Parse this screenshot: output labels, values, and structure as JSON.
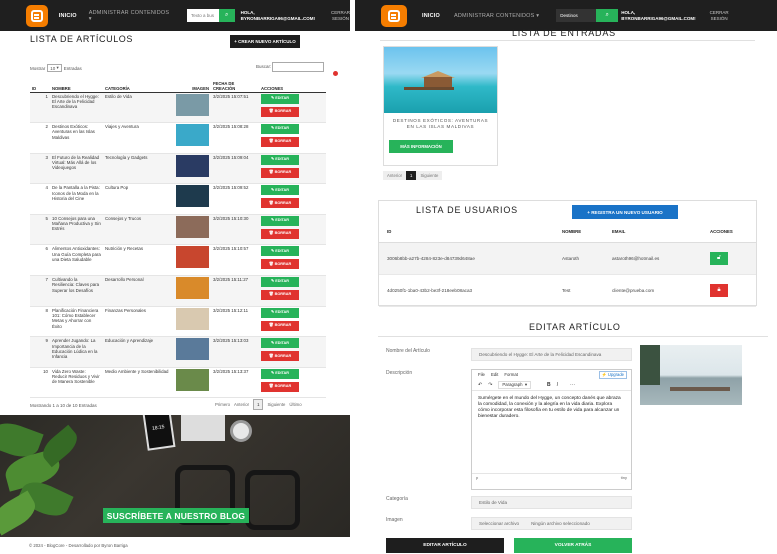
{
  "left": {
    "nav": {
      "home": "INICIO",
      "manage": "ADMINISTRAR CONTENIDOS",
      "search_placeholder": "Texto a bus",
      "user_line1": "HOLA,",
      "user_line2": "BYRONBARRIGA96@GMAIL.COM!",
      "logout_line1": "CERRAR",
      "logout_line2": "SESIÓN"
    },
    "title": "LISTA DE ARTÍCULOS",
    "new_button": "+ CREAR NUEVO ARTÍCULO",
    "show_label": "Mostrar",
    "show_value": "10",
    "entries_label": "Entradas",
    "search_label": "Buscar:",
    "columns": [
      "ID",
      "NOMBRE",
      "CATEGORÍA",
      "IMAGEN",
      "FECHA DE CREACIÓN",
      "ACCIONES"
    ],
    "edit_label": "✎ EDITAR",
    "delete_label": "🗑 BORRAR",
    "rows": [
      {
        "id": "1",
        "name": "Descubriendo el Hygge: El Arte de la Felicidad Escandinava",
        "category": "Estilo de Vida",
        "date": "3/2/2025 15:07:51",
        "img": "#7a9aa6"
      },
      {
        "id": "2",
        "name": "Destinos Exóticos: Aventuras en las Islas Maldivas",
        "category": "Viajes y Aventura",
        "date": "3/2/2025 15:08:28",
        "img": "#3aa9c9"
      },
      {
        "id": "3",
        "name": "El Futuro de la Realidad Virtual: Más Allá de los Videojuegos",
        "category": "Tecnología y Gadgets",
        "date": "3/2/2025 15:09:04",
        "img": "#2a3b63"
      },
      {
        "id": "4",
        "name": "De la Pantalla a la Pista: Iconos de la Moda en la Historia del Cine",
        "category": "Cultura Pop",
        "date": "3/2/2025 15:09:52",
        "img": "#1e3a4d"
      },
      {
        "id": "5",
        "name": "10 Consejos para una Mañana Productiva y Sin Estrés",
        "category": "Consejos y Trucos",
        "date": "3/2/2025 15:10:30",
        "img": "#8c6b5a"
      },
      {
        "id": "6",
        "name": "Alimentos Antioxidantes: Una Guía Completa para una Dieta Saludable",
        "category": "Nutrición y Recetas",
        "date": "3/2/2025 15:10:57",
        "img": "#c8462e"
      },
      {
        "id": "7",
        "name": "Cultivando la Resiliencia: Claves para Superar los Desafíos",
        "category": "Desarrollo Personal",
        "date": "3/2/2025 15:11:27",
        "img": "#d98a2a"
      },
      {
        "id": "8",
        "name": "Planificación Financiera 101: Cómo Establecer Metas y Ahorrar con Éxito",
        "category": "Finanzas Personales",
        "date": "3/2/2025 15:12:11",
        "img": "#d9c9b0"
      },
      {
        "id": "9",
        "name": "Aprender Jugando: La Importancia de la Educación Lúdica en la Infancia",
        "category": "Educación y Aprendizaje",
        "date": "3/2/2025 15:13:03",
        "img": "#5a7a9a"
      },
      {
        "id": "10",
        "name": "Vida Zero Waste: Reducir Residuos y Vivir de Manera Sostenible",
        "category": "Medio Ambiente y Sostenibilidad",
        "date": "3/2/2025 15:13:37",
        "img": "#6a8a4a"
      }
    ],
    "showing": "Mostrando 1 a 10 de 10 Entradas",
    "pager": {
      "first": "Primero",
      "prev": "Anterior",
      "current": "1",
      "next": "Siguiente",
      "last": "Último"
    },
    "hero_cta": "SUSCRÍBETE A NUESTRO BLOG",
    "hero_time": "18:15",
    "footer": "© 2024 - BlogCore - Desarrollado por Byron Barriga"
  },
  "right": {
    "nav": {
      "home": "INICIO",
      "manage": "ADMINISTRAR CONTENIDOS",
      "search_value": "Destinos",
      "user_line1": "HOLA,",
      "user_line2": "BYRONBARRIGA96@GMAIL.COM!",
      "logout_line1": "CERRAR",
      "logout_line2": "SESIÓN"
    },
    "entries_title": "LISTA DE ENTRADAS",
    "card_title": "DESTINOS EXÓTICOS: AVENTURAS EN LAS ISLAS MALDIVAS",
    "card_button": "MÁS INFORMACIÓN",
    "pager": {
      "prev": "Anterior",
      "current": "1",
      "next": "Siguiente"
    },
    "users_title": "LISTA DE USUARIOS",
    "users_button": "+ REGISTRA UN NUEVO USUARIO",
    "users_columns": [
      "ID",
      "NOMBRE",
      "EMAIL",
      "ACCIONES"
    ],
    "users": [
      {
        "id": "3006b8bb-a27b-4284-823e-d84739d648ae",
        "name": "Astaroth",
        "email": "astaroth96@hotmail.es",
        "action": "unlock"
      },
      {
        "id": "4d0250f1-1ba0-43b2-be3f-218eeb08aca3",
        "name": "Test",
        "email": "cliente@prueba.com",
        "action": "lock"
      }
    ],
    "edit_title": "EDITAR ARTÍCULO",
    "labels": {
      "name": "Nombre del Artículo",
      "description": "Descripción",
      "category": "Categoría",
      "image": "Imagen"
    },
    "name_value": "Descubriendo el Hygge: El Arte de la Felicidad Escandinava",
    "editor": {
      "menu": [
        "File",
        "Edit",
        "Format"
      ],
      "upgrade": "⚡ Upgrade",
      "paragraph": "Paragraph",
      "content": "Sumérgete en el mundo del Hygge, un concepto danés que abraza la comodidad, la conexión y la alegría en la vida diaria. Explora cómo incorporar esta filosofía en tu estilo de vida para alcanzar un bienestar duradero.",
      "status_left": "p",
      "status_right": "tiny"
    },
    "category_value": "Estilo de Vida",
    "file_button": "Seleccionar archivo",
    "file_none": "Ningún archivo seleccionado",
    "btn_edit": "EDITAR ARTÍCULO",
    "btn_back": "VOLVER ATRÁS"
  }
}
